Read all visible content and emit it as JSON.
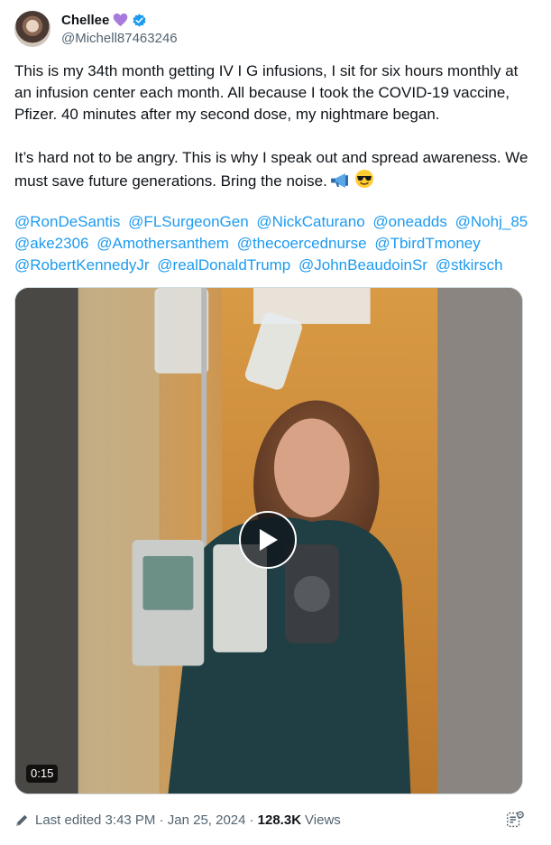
{
  "author": {
    "display_name": "Chellee",
    "handle": "@Michell87463246"
  },
  "tweet": {
    "paragraph1": "This is my 34th month getting IV I G infusions,  I sit for six hours monthly at an infusion center each month.  All because I took the COVID-19 vaccine, Pfizer.   40 minutes after my second dose, my nightmare began.",
    "paragraph2": "It’s hard not to be angry.  This is why I speak out and spread awareness.  We must save future generations.  Bring the  noise.",
    "mentions": [
      "@RonDeSantis",
      "@FLSurgeonGen",
      "@NickCaturano",
      "@oneadds",
      "@Nohj_85",
      "@ake2306",
      "@Amothersanthem",
      "@thecoercednurse",
      "@TbirdTmoney",
      "@RobertKennedyJr",
      "@realDonaldTrump",
      "@JohnBeaudoinSr",
      "@stkirsch"
    ]
  },
  "media": {
    "duration": "0:15"
  },
  "meta": {
    "edited": "Last edited 3:43 PM · Jan 25, 2024 ·",
    "views_count": "128.3K",
    "views_label": "Views"
  },
  "colors": {
    "accent": "#1d9bf0",
    "secondary_text": "#536471",
    "heart": "#a77bdb"
  },
  "icons": [
    "purple-heart-icon",
    "verified-badge-icon",
    "megaphone-icon",
    "sunglasses-emoji-icon",
    "play-icon",
    "edit-pencil-icon",
    "grok-icon"
  ]
}
